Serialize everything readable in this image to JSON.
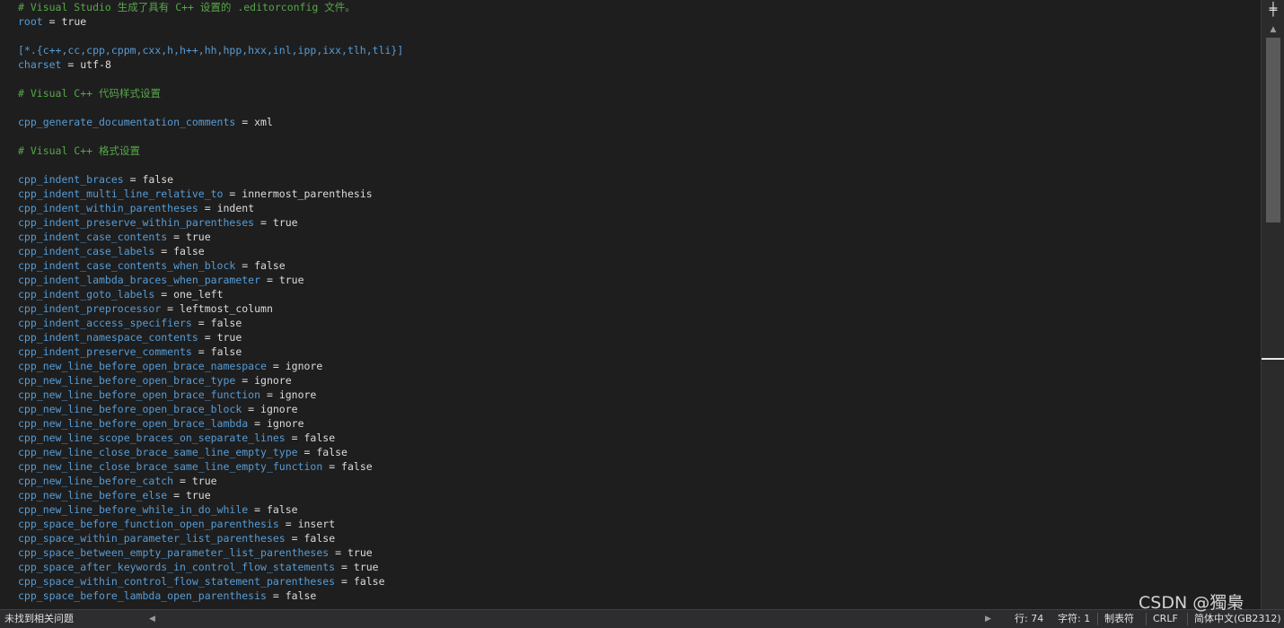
{
  "editor": {
    "lines": [
      {
        "type": "comment",
        "text": "# Visual Studio 生成了具有 C++ 设置的 .editorconfig 文件。"
      },
      {
        "type": "kv",
        "key": "root",
        "value": "true"
      },
      {
        "type": "blank"
      },
      {
        "type": "section",
        "text": "[*.{c++,cc,cpp,cppm,cxx,h,h++,hh,hpp,hxx,inl,ipp,ixx,tlh,tli}]"
      },
      {
        "type": "kv",
        "key": "charset",
        "value": "utf-8"
      },
      {
        "type": "blank"
      },
      {
        "type": "comment",
        "text": "# Visual C++ 代码样式设置"
      },
      {
        "type": "blank"
      },
      {
        "type": "kv",
        "key": "cpp_generate_documentation_comments",
        "value": "xml"
      },
      {
        "type": "blank"
      },
      {
        "type": "comment",
        "text": "# Visual C++ 格式设置"
      },
      {
        "type": "blank"
      },
      {
        "type": "kv",
        "key": "cpp_indent_braces",
        "value": "false"
      },
      {
        "type": "kv",
        "key": "cpp_indent_multi_line_relative_to",
        "value": "innermost_parenthesis"
      },
      {
        "type": "kv",
        "key": "cpp_indent_within_parentheses",
        "value": "indent"
      },
      {
        "type": "kv",
        "key": "cpp_indent_preserve_within_parentheses",
        "value": "true"
      },
      {
        "type": "kv",
        "key": "cpp_indent_case_contents",
        "value": "true"
      },
      {
        "type": "kv",
        "key": "cpp_indent_case_labels",
        "value": "false"
      },
      {
        "type": "kv",
        "key": "cpp_indent_case_contents_when_block",
        "value": "false"
      },
      {
        "type": "kv",
        "key": "cpp_indent_lambda_braces_when_parameter",
        "value": "true"
      },
      {
        "type": "kv",
        "key": "cpp_indent_goto_labels",
        "value": "one_left"
      },
      {
        "type": "kv",
        "key": "cpp_indent_preprocessor",
        "value": "leftmost_column"
      },
      {
        "type": "kv",
        "key": "cpp_indent_access_specifiers",
        "value": "false"
      },
      {
        "type": "kv",
        "key": "cpp_indent_namespace_contents",
        "value": "true"
      },
      {
        "type": "kv",
        "key": "cpp_indent_preserve_comments",
        "value": "false"
      },
      {
        "type": "kv",
        "key": "cpp_new_line_before_open_brace_namespace",
        "value": "ignore"
      },
      {
        "type": "kv",
        "key": "cpp_new_line_before_open_brace_type",
        "value": "ignore"
      },
      {
        "type": "kv",
        "key": "cpp_new_line_before_open_brace_function",
        "value": "ignore"
      },
      {
        "type": "kv",
        "key": "cpp_new_line_before_open_brace_block",
        "value": "ignore"
      },
      {
        "type": "kv",
        "key": "cpp_new_line_before_open_brace_lambda",
        "value": "ignore"
      },
      {
        "type": "kv",
        "key": "cpp_new_line_scope_braces_on_separate_lines",
        "value": "false"
      },
      {
        "type": "kv",
        "key": "cpp_new_line_close_brace_same_line_empty_type",
        "value": "false"
      },
      {
        "type": "kv",
        "key": "cpp_new_line_close_brace_same_line_empty_function",
        "value": "false"
      },
      {
        "type": "kv",
        "key": "cpp_new_line_before_catch",
        "value": "true"
      },
      {
        "type": "kv",
        "key": "cpp_new_line_before_else",
        "value": "true"
      },
      {
        "type": "kv",
        "key": "cpp_new_line_before_while_in_do_while",
        "value": "false"
      },
      {
        "type": "kv",
        "key": "cpp_space_before_function_open_parenthesis",
        "value": "insert"
      },
      {
        "type": "kv",
        "key": "cpp_space_within_parameter_list_parentheses",
        "value": "false"
      },
      {
        "type": "kv",
        "key": "cpp_space_between_empty_parameter_list_parentheses",
        "value": "true"
      },
      {
        "type": "kv",
        "key": "cpp_space_after_keywords_in_control_flow_statements",
        "value": "true"
      },
      {
        "type": "kv",
        "key": "cpp_space_within_control_flow_statement_parentheses",
        "value": "false"
      },
      {
        "type": "kv",
        "key": "cpp_space_before_lambda_open_parenthesis",
        "value": "false"
      }
    ]
  },
  "scrollbar": {
    "split_icon": "split-window-icon",
    "split_glyph": "╪",
    "up_glyph": "▲"
  },
  "statusbar": {
    "issues": "未找到相关问题",
    "hscroll_left_glyph": "◀",
    "hscroll_right_glyph": "▶",
    "line": "行: 74",
    "char": "字符: 1",
    "tabs": "制表符",
    "eol": "CRLF",
    "encoding": "简体中文(GB2312)"
  },
  "watermark": "CSDN @獨梟",
  "colors": {
    "background": "#1e1e1e",
    "comment": "#57a64a",
    "key": "#569cd6",
    "value": "#dcdcdc"
  }
}
